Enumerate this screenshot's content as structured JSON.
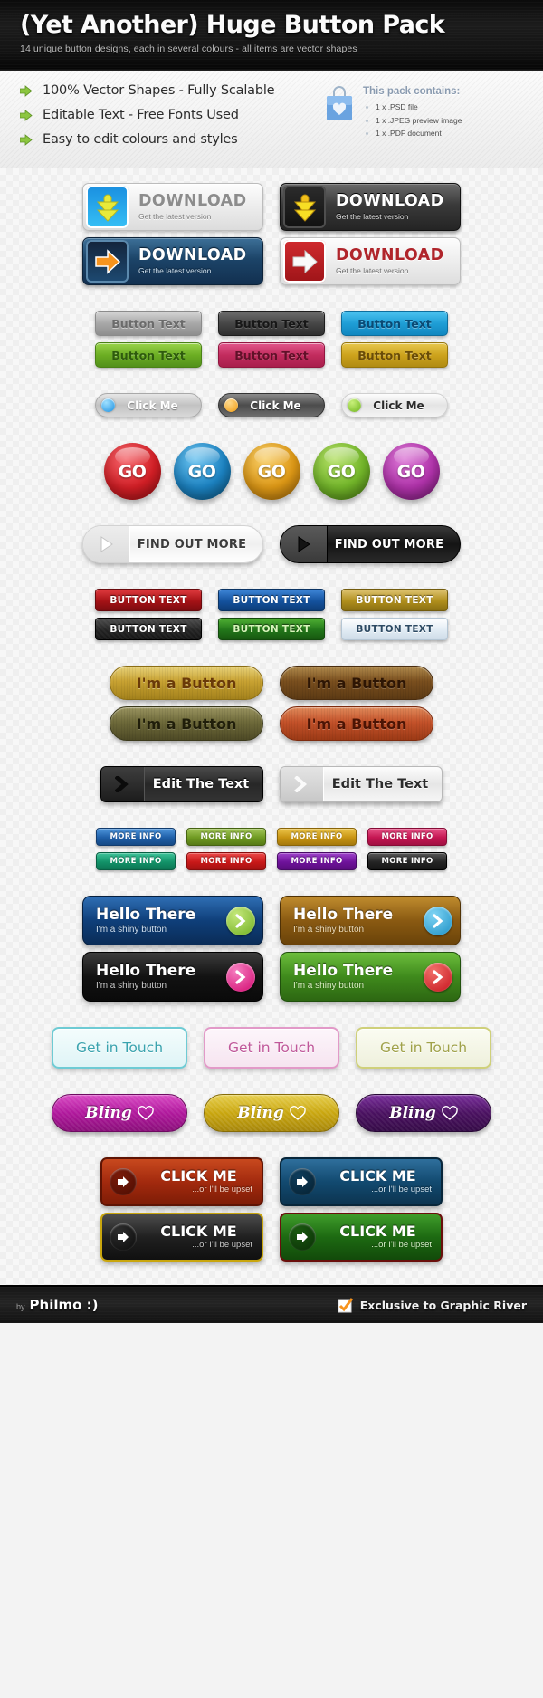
{
  "header": {
    "title": "(Yet Another) Huge Button Pack",
    "subtitle": "14 unique button designs, each in several colours - all items are vector shapes"
  },
  "features": {
    "bullets": [
      "100% Vector Shapes - Fully Scalable",
      "Editable Text - Free Fonts Used",
      "Easy to edit colours and styles"
    ],
    "pack_title": "This pack contains:",
    "pack_items": [
      "1 x .PSD file",
      "1 x .JPEG preview image",
      "1 x .PDF document"
    ],
    "arrow_icon": "arrow-right-icon",
    "bag_icon": "shopping-bag-heart-icon"
  },
  "sets": {
    "download": {
      "label": "DOWNLOAD",
      "sub": "Get the latest version",
      "icon_down": "download-arrow-icon",
      "icon_right": "arrow-right-icon",
      "variants": [
        "silver-blue",
        "dark-gold",
        "navy-orange",
        "white-red"
      ]
    },
    "button_text_glossy": {
      "label": "Button Text",
      "colors": [
        "#9a9a9a",
        "#4a4a4a",
        "#2ca8e0",
        "#76bb2a",
        "#cf3566",
        "#d1a524"
      ]
    },
    "click_me": {
      "label": "Click Me",
      "dots": [
        "#2aa7ef",
        "#f0a020",
        "#7ac424"
      ],
      "variants": [
        "grey",
        "dark",
        "light"
      ]
    },
    "go": {
      "label": "GO",
      "colors": [
        "#d51f26",
        "#1c84c4",
        "#e09a16",
        "#74b82a",
        "#b233ac"
      ]
    },
    "find_out_more": {
      "label": "FIND OUT MORE",
      "icon": "play-triangle-icon",
      "variants": [
        "light",
        "dark"
      ]
    },
    "button_text_rect": {
      "label": "BUTTON TEXT",
      "colors": [
        "#b01418",
        "#1552a8",
        "#b99322",
        "#2e2e2e",
        "#2a7a1b",
        "#dfe9f2"
      ]
    },
    "im_a_button": {
      "label": "I'm a Button",
      "colors": [
        "#c8a232",
        "#7a4f1e",
        "#6e6a3a",
        "#c4522a"
      ]
    },
    "edit_the_text": {
      "label": "Edit The Text",
      "icon": "chevron-right-icon",
      "variants": [
        "dark",
        "light"
      ]
    },
    "more_info": {
      "label": "MORE INFO",
      "colors": [
        "#2a72c4",
        "#7aa828",
        "#d6a616",
        "#d41e5c",
        "#18a070",
        "#d62020",
        "#7a19a8",
        "#2b2b2b"
      ]
    },
    "hello_there": {
      "title": "Hello There",
      "sub": "I'm a shiny button",
      "icon": "chevron-right-circle-icon",
      "variants": [
        {
          "bg": "#0f3f7a",
          "circle": "#8dc63f"
        },
        {
          "bg": "#8a5a12",
          "circle": "#29abe2"
        },
        {
          "bg": "#1a1a1a",
          "circle": "#e6177f"
        },
        {
          "bg": "#3f8a1c",
          "circle": "#d9232e"
        }
      ]
    },
    "get_in_touch": {
      "label": "Get in Touch",
      "colors": [
        "#6ecbd4",
        "#e29ac8",
        "#cfd07a"
      ]
    },
    "bling": {
      "label": "Bling",
      "icon": "heart-icon",
      "colors": [
        "#b0189c",
        "#c9a60e",
        "#4a1160"
      ]
    },
    "click_me_big": {
      "title": "CLICK ME",
      "sub": "...or I'll be upset",
      "icon": "arrow-right-icon",
      "variants": [
        "red",
        "blue",
        "dark-yellow",
        "green"
      ]
    }
  },
  "footer": {
    "by_prefix": "by",
    "author": "Philmo :)",
    "exclusive": "Exclusive to Graphic River",
    "check_icon": "checkbox-checked-icon"
  }
}
